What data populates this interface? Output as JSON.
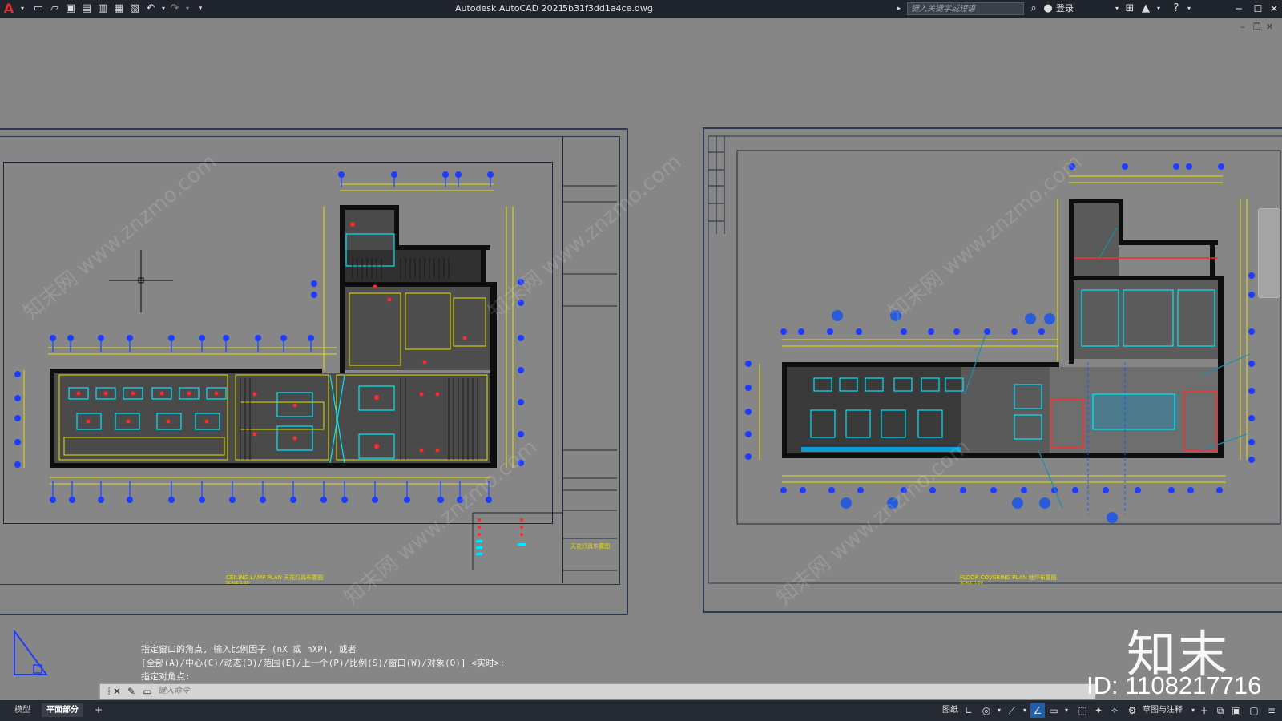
{
  "titlebar": {
    "app_title": "Autodesk AutoCAD 2021",
    "file_name": "5b31f3dd1a4ce.dwg",
    "search_placeholder": "键入关键字或短语",
    "login_label": "登录"
  },
  "icons": {
    "logo": "autocad-logo-icon",
    "new": "new-file-icon",
    "open": "open-folder-icon",
    "save": "save-icon",
    "saveas": "save-as-icon",
    "publish": "publish-icon",
    "print": "print-icon",
    "undo": "undo-icon",
    "redo": "redo-icon"
  },
  "drawing": {
    "left_title": "CEILING LAMP PLAN 天花灯具布置图",
    "left_scale": "SCALE  1:80",
    "right_title": "FLOOR COVERING PLAN 地坪布置图",
    "right_scale": "SCALE  1:80",
    "left_block_title": "天花灯具布置图",
    "watermark_text": "知末网 www.znzmo.com"
  },
  "command": {
    "history": [
      "指定窗口的角点, 输入比例因子 (nX 或 nXP), 或者",
      "[全部(A)/中心(C)/动态(D)/范围(E)/上一个(P)/比例(S)/窗口(W)/对象(O)] <实时>:",
      "指定对角点:"
    ],
    "input_placeholder": "键入命令"
  },
  "statusbar": {
    "tabs": [
      "模型",
      "平面部分"
    ],
    "active_tab": "平面部分",
    "paper_label": "图纸",
    "workspace_label": "草图与注释"
  },
  "brand": {
    "logo_text": "知末",
    "id_text": "ID: 1108217716"
  },
  "colors": {
    "canvas": "#868686",
    "titlebar": "#20242c",
    "accent_cyan": "#00e5ff",
    "accent_yellow": "#ffff00",
    "accent_red": "#ff2020",
    "blue_dims": "#2a50ff"
  }
}
